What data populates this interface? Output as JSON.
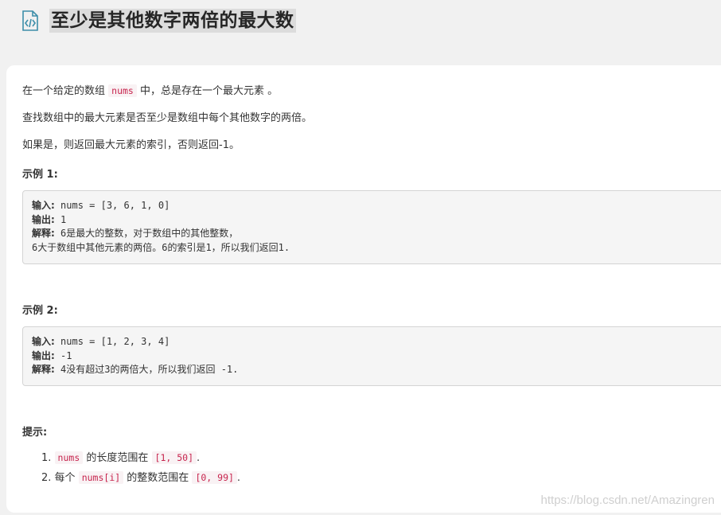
{
  "title": "至少是其他数字两倍的最大数",
  "description": {
    "p1_before": "在一个给定的数组",
    "p1_code": "nums",
    "p1_after": "中，总是存在一个最大元素 。",
    "p2": "查找数组中的最大元素是否至少是数组中每个其他数字的两倍。",
    "p3": "如果是，则返回最大元素的索引，否则返回-1。"
  },
  "example1": {
    "title": "示例 1:",
    "input_label": "输入:",
    "input_value": " nums = [3, 6, 1, 0]",
    "output_label": "输出:",
    "output_value": " 1",
    "explain_label": "解释:",
    "explain_line1": " 6是最大的整数，对于数组中的其他整数，",
    "explain_line2": "6大于数组中其他元素的两倍。6的索引是1，所以我们返回1."
  },
  "example2": {
    "title": "示例 2:",
    "input_label": "输入:",
    "input_value": " nums = [1, 2, 3, 4]",
    "output_label": "输出:",
    "output_value": " -1",
    "explain_label": "解释:",
    "explain_line1": " 4没有超过3的两倍大，所以我们返回 -1."
  },
  "hints": {
    "title": "提示:",
    "items": [
      {
        "num": "1.",
        "code1": "nums",
        "mid": " 的长度范围在",
        "code2": "[1, 50]",
        "end": "."
      },
      {
        "num": "2.",
        "pre": "每个",
        "code1": "nums[i]",
        "mid": " 的整数范围在",
        "code2": "[0, 99]",
        "end": "."
      }
    ]
  },
  "watermark": "https://blog.csdn.net/Amazingren",
  "colors": {
    "page_bg": "#f1f1f1",
    "card_bg": "#ffffff",
    "code_text": "#c7254e",
    "icon": "#3d8ea9"
  }
}
